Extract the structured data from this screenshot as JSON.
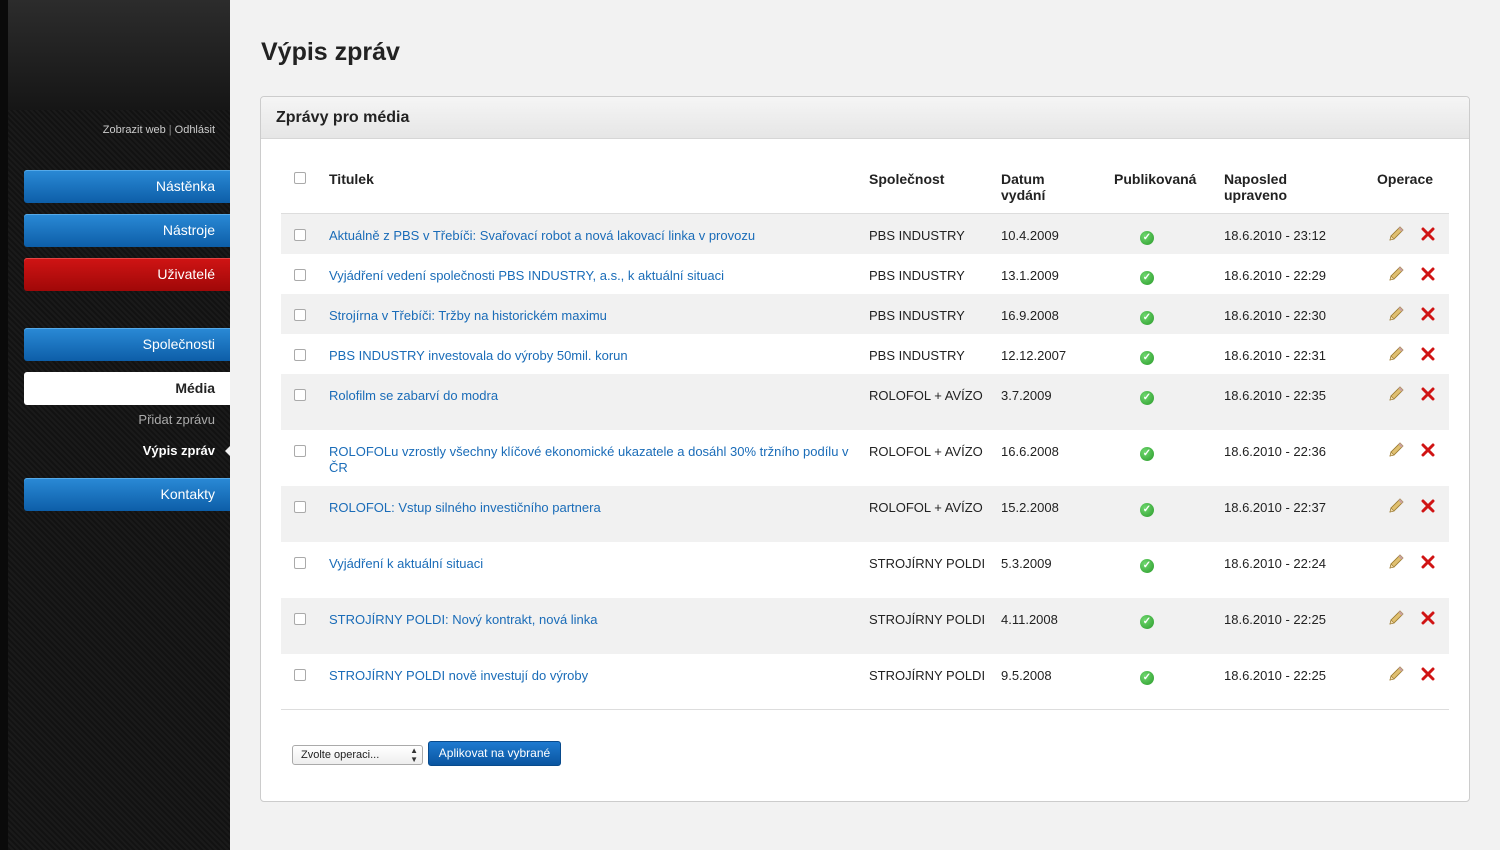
{
  "sidebar": {
    "top_links": {
      "show_web": "Zobrazit web",
      "separator": "|",
      "logout": "Odhlásit"
    },
    "nav": {
      "dashboard": "Nástěnka",
      "tools": "Nástroje",
      "users": "Uživatelé",
      "companies": "Společnosti",
      "media": "Média",
      "add_message": "Přidat zprávu",
      "list_messages": "Výpis zpráv",
      "contacts": "Kontakty"
    },
    "colors": {
      "nav_blue": "#0d5ea8",
      "nav_red": "#a00808"
    }
  },
  "page": {
    "title": "Výpis zpráv"
  },
  "panel": {
    "title": "Zprávy pro média",
    "columns": {
      "title": "Titulek",
      "company": "Společnost",
      "date": "Datum vydání",
      "published": "Publikovaná",
      "updated": "Naposled upraveno",
      "operations": "Operace"
    },
    "rows": [
      {
        "title": "Aktuálně z PBS v Třebíči: Svařovací robot a nová lakovací linka v provozu",
        "company": "PBS INDUSTRY",
        "date": "10.4.2009",
        "published": true,
        "updated": "18.6.2010 - 23:12"
      },
      {
        "title": "Vyjádření vedení společnosti PBS INDUSTRY, a.s., k aktuální situaci",
        "company": "PBS INDUSTRY",
        "date": "13.1.2009",
        "published": true,
        "updated": "18.6.2010 - 22:29"
      },
      {
        "title": "Strojírna v Třebíči: Tržby na historickém maximu",
        "company": "PBS INDUSTRY",
        "date": "16.9.2008",
        "published": true,
        "updated": "18.6.2010 - 22:30"
      },
      {
        "title": "PBS INDUSTRY investovala do výroby 50mil. korun",
        "company": "PBS INDUSTRY",
        "date": "12.12.2007",
        "published": true,
        "updated": "18.6.2010 - 22:31"
      },
      {
        "title": "Rolofilm se zabarví do modra",
        "company": "ROLOFOL + AVÍZO",
        "date": "3.7.2009",
        "published": true,
        "updated": "18.6.2010 - 22:35"
      },
      {
        "title": "ROLOFOLu vzrostly všechny klíčové ekonomické ukazatele a dosáhl 30% tržního podílu v ČR",
        "company": "ROLOFOL + AVÍZO",
        "date": "16.6.2008",
        "published": true,
        "updated": "18.6.2010 - 22:36"
      },
      {
        "title": "ROLOFOL: Vstup silného investičního partnera",
        "company": "ROLOFOL + AVÍZO",
        "date": "15.2.2008",
        "published": true,
        "updated": "18.6.2010 - 22:37"
      },
      {
        "title": "Vyjádření k aktuální situaci",
        "company": "STROJÍRNY POLDI",
        "date": "5.3.2009",
        "published": true,
        "updated": "18.6.2010 - 22:24"
      },
      {
        "title": "STROJÍRNY POLDI: Nový kontrakt, nová linka",
        "company": "STROJÍRNY POLDI",
        "date": "4.11.2008",
        "published": true,
        "updated": "18.6.2010 - 22:25"
      },
      {
        "title": "STROJÍRNY POLDI nově investují do výroby",
        "company": "STROJÍRNY POLDI",
        "date": "9.5.2008",
        "published": true,
        "updated": "18.6.2010 - 22:25"
      }
    ],
    "bulk": {
      "select_value": "Zvolte operaci...",
      "apply_label": "Aplikovat na vybrané"
    },
    "icons": {
      "published": "check-circle-icon",
      "edit": "pencil-icon",
      "delete": "x-icon"
    },
    "colors": {
      "link": "#1a6cb8",
      "delete": "#d01414",
      "published": "#2a9a2a"
    }
  }
}
